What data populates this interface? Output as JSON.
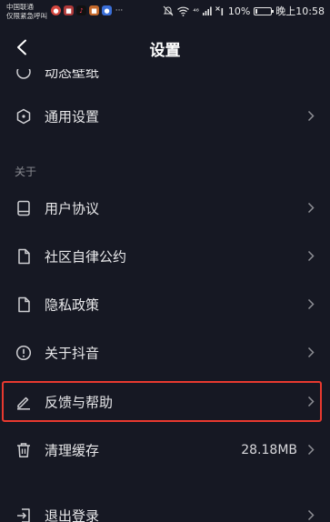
{
  "status_bar": {
    "carrier_line1": "中国联通",
    "carrier_line2": "仅限紧急呼叫",
    "more_dots": "···",
    "network": "⁴⁶",
    "battery_percent": "10%",
    "time": "晚上10:58"
  },
  "nav": {
    "title": "设置"
  },
  "settings": {
    "partial_label": "动态壁纸",
    "general": "通用设置",
    "about_header": "关于",
    "user_agreement": "用户协议",
    "community": "社区自律公约",
    "privacy": "隐私政策",
    "about_app": "关于抖音",
    "feedback": "反馈与帮助",
    "clear_cache": "清理缓存",
    "cache_size": "28.18MB",
    "logout": "退出登录"
  },
  "colors": {
    "background": "#161823",
    "highlight": "#e8392f"
  }
}
